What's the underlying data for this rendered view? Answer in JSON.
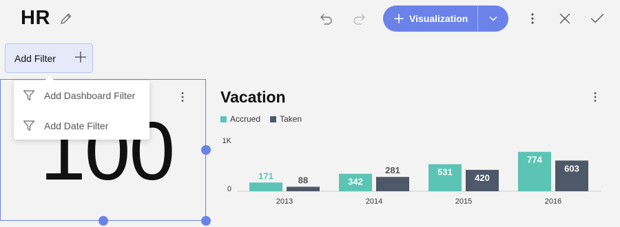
{
  "header": {
    "title": "HR",
    "visualization_button": "Visualization"
  },
  "toolbar_icons": [
    "pencil-icon",
    "undo-icon",
    "redo-icon",
    "more-vert-icon",
    "close-icon",
    "check-icon"
  ],
  "filter": {
    "add_filter_label": "Add Filter",
    "menu": [
      {
        "label": "Add Dashboard Filter",
        "icon": "filter-icon"
      },
      {
        "label": "Add Date Filter",
        "icon": "filter-icon"
      }
    ]
  },
  "kpi_widget": {
    "value": "100"
  },
  "chart_widget": {
    "title": "Vacation"
  },
  "colors": {
    "accent": "#6b82e8",
    "accrued": "#5cc4b4",
    "taken": "#4d5868"
  },
  "chart_data": {
    "type": "bar",
    "title": "Vacation",
    "categories": [
      "2013",
      "2014",
      "2015",
      "2016"
    ],
    "series": [
      {
        "name": "Accrued",
        "values": [
          171,
          342,
          531,
          774
        ]
      },
      {
        "name": "Taken",
        "values": [
          88,
          281,
          420,
          603
        ]
      }
    ],
    "ylim": [
      0,
      1000
    ],
    "ytick_labels": [
      "0",
      "1K"
    ],
    "legend": "top-left",
    "grid": false
  }
}
